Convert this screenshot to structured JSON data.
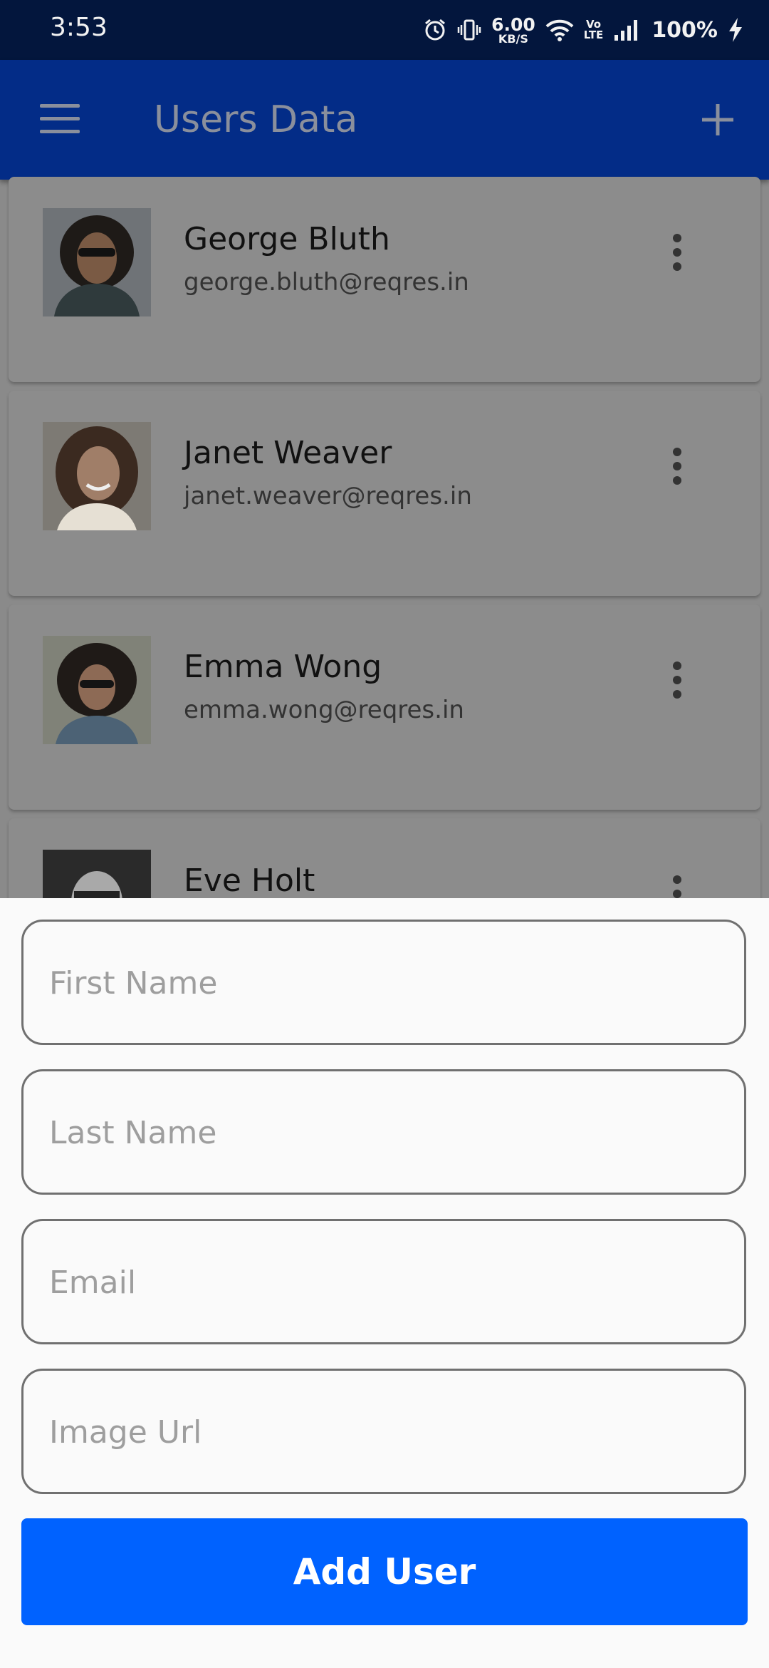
{
  "status_bar": {
    "time": "3:53",
    "net_speed_value": "6.00",
    "net_speed_unit": "KB/S",
    "volte_top": "Vo",
    "volte_bottom": "LTE",
    "battery": "100%",
    "icons": [
      "alarm-icon",
      "vibrate-icon",
      "wifi-icon",
      "signal-icon",
      "charging-icon"
    ]
  },
  "app_bar": {
    "title": "Users Data",
    "menu_icon": "hamburger-menu-icon",
    "add_icon": "plus-icon"
  },
  "users": [
    {
      "name": "George Bluth",
      "email": "george.bluth@reqres.in"
    },
    {
      "name": "Janet Weaver",
      "email": "janet.weaver@reqres.in"
    },
    {
      "name": "Emma Wong",
      "email": "emma.wong@reqres.in"
    },
    {
      "name": "Eve Holt",
      "email": ""
    }
  ],
  "form": {
    "first_name_placeholder": "First Name",
    "last_name_placeholder": "Last Name",
    "email_placeholder": "Email",
    "image_url_placeholder": "Image Url",
    "submit_label": "Add User"
  },
  "colors": {
    "status_bar": "#03163d",
    "app_bar": "#032c87",
    "button": "#0062ff",
    "scrim": "#8a8a8a",
    "sheet": "#fafafa"
  }
}
